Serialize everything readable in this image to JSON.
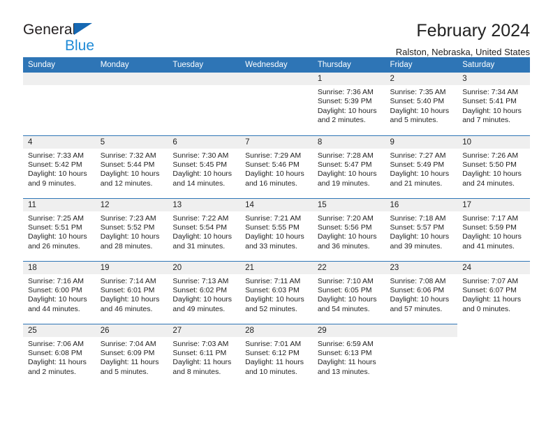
{
  "brand": {
    "name_top": "General",
    "name_bottom": "Blue",
    "triangle_color": "#1668b3",
    "blue_color": "#1f8ad6"
  },
  "header": {
    "month_title": "February 2024",
    "location": "Ralston, Nebraska, United States"
  },
  "theme": {
    "header_blue": "#2e75b6",
    "daynum_gray": "#efefef",
    "rule_blue": "#2e75b6"
  },
  "weekday_headers": [
    "Sunday",
    "Monday",
    "Tuesday",
    "Wednesday",
    "Thursday",
    "Friday",
    "Saturday"
  ],
  "labels": {
    "sunrise": "Sunrise:",
    "sunset": "Sunset:",
    "daylight": "Daylight:"
  },
  "weeks": [
    [
      {
        "day": "",
        "sunrise": "",
        "sunset": "",
        "daylight_line1": "",
        "daylight_line2": ""
      },
      {
        "day": "",
        "sunrise": "",
        "sunset": "",
        "daylight_line1": "",
        "daylight_line2": ""
      },
      {
        "day": "",
        "sunrise": "",
        "sunset": "",
        "daylight_line1": "",
        "daylight_line2": ""
      },
      {
        "day": "",
        "sunrise": "",
        "sunset": "",
        "daylight_line1": "",
        "daylight_line2": ""
      },
      {
        "day": "1",
        "sunrise": "Sunrise: 7:36 AM",
        "sunset": "Sunset: 5:39 PM",
        "daylight_line1": "Daylight: 10 hours",
        "daylight_line2": "and 2 minutes."
      },
      {
        "day": "2",
        "sunrise": "Sunrise: 7:35 AM",
        "sunset": "Sunset: 5:40 PM",
        "daylight_line1": "Daylight: 10 hours",
        "daylight_line2": "and 5 minutes."
      },
      {
        "day": "3",
        "sunrise": "Sunrise: 7:34 AM",
        "sunset": "Sunset: 5:41 PM",
        "daylight_line1": "Daylight: 10 hours",
        "daylight_line2": "and 7 minutes."
      }
    ],
    [
      {
        "day": "4",
        "sunrise": "Sunrise: 7:33 AM",
        "sunset": "Sunset: 5:42 PM",
        "daylight_line1": "Daylight: 10 hours",
        "daylight_line2": "and 9 minutes."
      },
      {
        "day": "5",
        "sunrise": "Sunrise: 7:32 AM",
        "sunset": "Sunset: 5:44 PM",
        "daylight_line1": "Daylight: 10 hours",
        "daylight_line2": "and 12 minutes."
      },
      {
        "day": "6",
        "sunrise": "Sunrise: 7:30 AM",
        "sunset": "Sunset: 5:45 PM",
        "daylight_line1": "Daylight: 10 hours",
        "daylight_line2": "and 14 minutes."
      },
      {
        "day": "7",
        "sunrise": "Sunrise: 7:29 AM",
        "sunset": "Sunset: 5:46 PM",
        "daylight_line1": "Daylight: 10 hours",
        "daylight_line2": "and 16 minutes."
      },
      {
        "day": "8",
        "sunrise": "Sunrise: 7:28 AM",
        "sunset": "Sunset: 5:47 PM",
        "daylight_line1": "Daylight: 10 hours",
        "daylight_line2": "and 19 minutes."
      },
      {
        "day": "9",
        "sunrise": "Sunrise: 7:27 AM",
        "sunset": "Sunset: 5:49 PM",
        "daylight_line1": "Daylight: 10 hours",
        "daylight_line2": "and 21 minutes."
      },
      {
        "day": "10",
        "sunrise": "Sunrise: 7:26 AM",
        "sunset": "Sunset: 5:50 PM",
        "daylight_line1": "Daylight: 10 hours",
        "daylight_line2": "and 24 minutes."
      }
    ],
    [
      {
        "day": "11",
        "sunrise": "Sunrise: 7:25 AM",
        "sunset": "Sunset: 5:51 PM",
        "daylight_line1": "Daylight: 10 hours",
        "daylight_line2": "and 26 minutes."
      },
      {
        "day": "12",
        "sunrise": "Sunrise: 7:23 AM",
        "sunset": "Sunset: 5:52 PM",
        "daylight_line1": "Daylight: 10 hours",
        "daylight_line2": "and 28 minutes."
      },
      {
        "day": "13",
        "sunrise": "Sunrise: 7:22 AM",
        "sunset": "Sunset: 5:54 PM",
        "daylight_line1": "Daylight: 10 hours",
        "daylight_line2": "and 31 minutes."
      },
      {
        "day": "14",
        "sunrise": "Sunrise: 7:21 AM",
        "sunset": "Sunset: 5:55 PM",
        "daylight_line1": "Daylight: 10 hours",
        "daylight_line2": "and 33 minutes."
      },
      {
        "day": "15",
        "sunrise": "Sunrise: 7:20 AM",
        "sunset": "Sunset: 5:56 PM",
        "daylight_line1": "Daylight: 10 hours",
        "daylight_line2": "and 36 minutes."
      },
      {
        "day": "16",
        "sunrise": "Sunrise: 7:18 AM",
        "sunset": "Sunset: 5:57 PM",
        "daylight_line1": "Daylight: 10 hours",
        "daylight_line2": "and 39 minutes."
      },
      {
        "day": "17",
        "sunrise": "Sunrise: 7:17 AM",
        "sunset": "Sunset: 5:59 PM",
        "daylight_line1": "Daylight: 10 hours",
        "daylight_line2": "and 41 minutes."
      }
    ],
    [
      {
        "day": "18",
        "sunrise": "Sunrise: 7:16 AM",
        "sunset": "Sunset: 6:00 PM",
        "daylight_line1": "Daylight: 10 hours",
        "daylight_line2": "and 44 minutes."
      },
      {
        "day": "19",
        "sunrise": "Sunrise: 7:14 AM",
        "sunset": "Sunset: 6:01 PM",
        "daylight_line1": "Daylight: 10 hours",
        "daylight_line2": "and 46 minutes."
      },
      {
        "day": "20",
        "sunrise": "Sunrise: 7:13 AM",
        "sunset": "Sunset: 6:02 PM",
        "daylight_line1": "Daylight: 10 hours",
        "daylight_line2": "and 49 minutes."
      },
      {
        "day": "21",
        "sunrise": "Sunrise: 7:11 AM",
        "sunset": "Sunset: 6:03 PM",
        "daylight_line1": "Daylight: 10 hours",
        "daylight_line2": "and 52 minutes."
      },
      {
        "day": "22",
        "sunrise": "Sunrise: 7:10 AM",
        "sunset": "Sunset: 6:05 PM",
        "daylight_line1": "Daylight: 10 hours",
        "daylight_line2": "and 54 minutes."
      },
      {
        "day": "23",
        "sunrise": "Sunrise: 7:08 AM",
        "sunset": "Sunset: 6:06 PM",
        "daylight_line1": "Daylight: 10 hours",
        "daylight_line2": "and 57 minutes."
      },
      {
        "day": "24",
        "sunrise": "Sunrise: 7:07 AM",
        "sunset": "Sunset: 6:07 PM",
        "daylight_line1": "Daylight: 11 hours",
        "daylight_line2": "and 0 minutes."
      }
    ],
    [
      {
        "day": "25",
        "sunrise": "Sunrise: 7:06 AM",
        "sunset": "Sunset: 6:08 PM",
        "daylight_line1": "Daylight: 11 hours",
        "daylight_line2": "and 2 minutes."
      },
      {
        "day": "26",
        "sunrise": "Sunrise: 7:04 AM",
        "sunset": "Sunset: 6:09 PM",
        "daylight_line1": "Daylight: 11 hours",
        "daylight_line2": "and 5 minutes."
      },
      {
        "day": "27",
        "sunrise": "Sunrise: 7:03 AM",
        "sunset": "Sunset: 6:11 PM",
        "daylight_line1": "Daylight: 11 hours",
        "daylight_line2": "and 8 minutes."
      },
      {
        "day": "28",
        "sunrise": "Sunrise: 7:01 AM",
        "sunset": "Sunset: 6:12 PM",
        "daylight_line1": "Daylight: 11 hours",
        "daylight_line2": "and 10 minutes."
      },
      {
        "day": "29",
        "sunrise": "Sunrise: 6:59 AM",
        "sunset": "Sunset: 6:13 PM",
        "daylight_line1": "Daylight: 11 hours",
        "daylight_line2": "and 13 minutes."
      },
      {
        "day": "",
        "sunrise": "",
        "sunset": "",
        "daylight_line1": "",
        "daylight_line2": ""
      },
      {
        "day": "",
        "sunrise": "",
        "sunset": "",
        "daylight_line1": "",
        "daylight_line2": ""
      }
    ]
  ]
}
